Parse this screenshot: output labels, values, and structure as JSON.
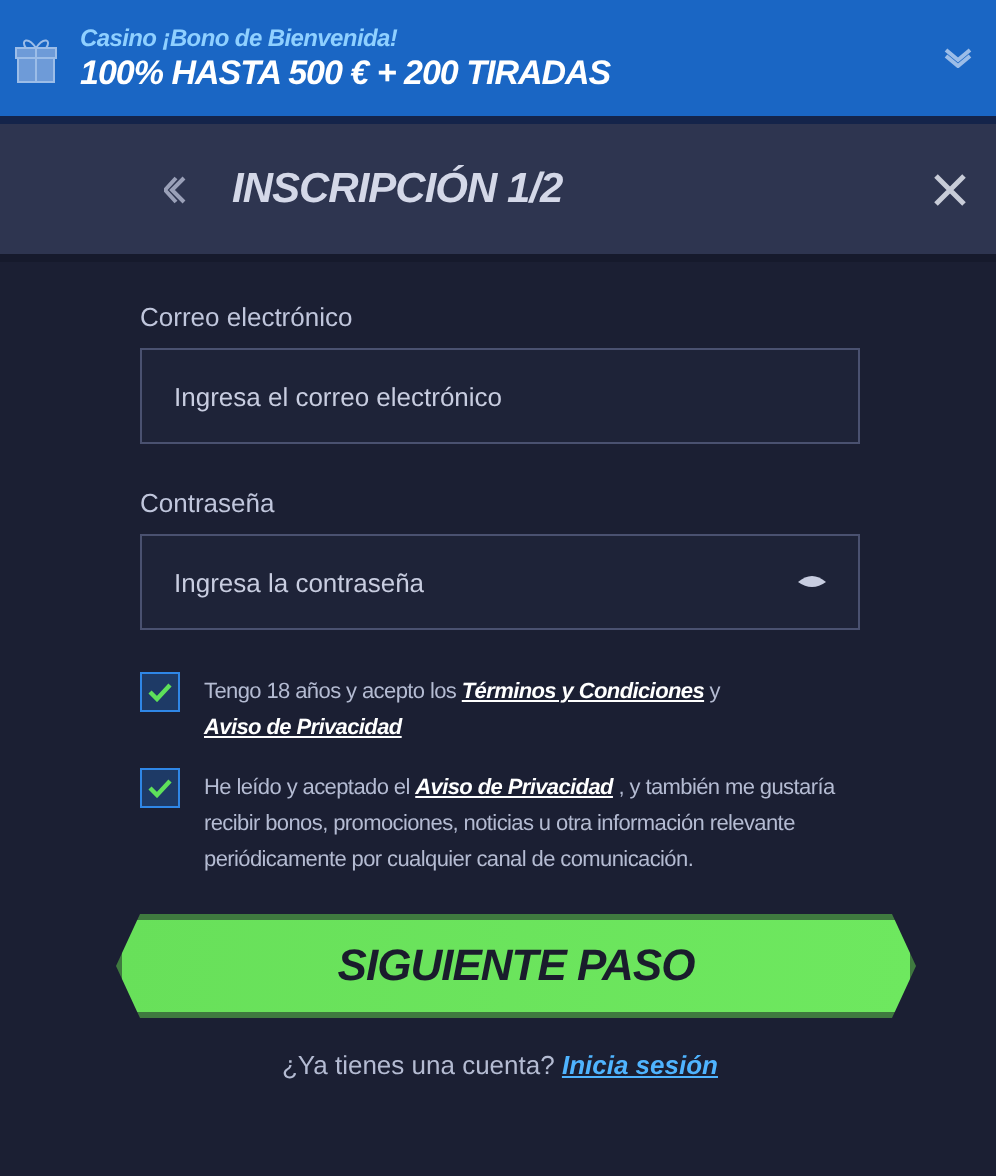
{
  "banner": {
    "subtitle": "Casino ¡Bono de Bienvenida!",
    "title": "100% HASTA 500 € + 200 TIRADAS"
  },
  "header": {
    "title": "INSCRIPCIÓN 1/2"
  },
  "fields": [
    {
      "label": "Correo electrónico",
      "placeholder": "Ingresa el correo electrónico",
      "kind": "email"
    },
    {
      "label": "Contraseña",
      "placeholder": "Ingresa la contraseña",
      "kind": "password"
    }
  ],
  "consents": [
    {
      "checked": true,
      "parts": [
        {
          "kind": "text",
          "text": "Tengo 18 años y acepto los "
        },
        {
          "kind": "link",
          "text": "Términos y Condiciones"
        },
        {
          "kind": "text",
          "text": " y "
        },
        {
          "kind": "link",
          "text": "Aviso de Privacidad"
        }
      ]
    },
    {
      "checked": true,
      "parts": [
        {
          "kind": "text",
          "text": "He leído y aceptado el "
        },
        {
          "kind": "link",
          "text": "Aviso de Privacidad"
        },
        {
          "kind": "text",
          "text": " , y también me gustaría recibir bonos, promociones, noticias u otra información relevante periódicamente por cualquier canal de comunicación."
        }
      ]
    }
  ],
  "submit": "SIGUIENTE PASO",
  "footer": {
    "text": "¿Ya tienes una cuenta?",
    "link": "Inicia sesión"
  }
}
